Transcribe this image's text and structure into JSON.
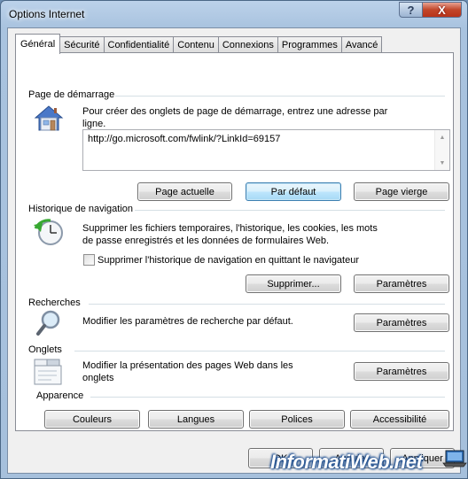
{
  "window": {
    "title": "Options Internet",
    "help_label": "?",
    "close_label": "X"
  },
  "tabs": [
    {
      "label": "Général"
    },
    {
      "label": "Sécurité"
    },
    {
      "label": "Confidentialité"
    },
    {
      "label": "Contenu"
    },
    {
      "label": "Connexions"
    },
    {
      "label": "Programmes"
    },
    {
      "label": "Avancé"
    }
  ],
  "homepage": {
    "title": "Page de démarrage",
    "description": "Pour créer des onglets de page de démarrage, entrez une adresse par ligne.",
    "url_value": "http://go.microsoft.com/fwlink/?LinkId=69157",
    "current_page_label": "Page actuelle",
    "default_label": "Par défaut",
    "blank_label": "Page vierge"
  },
  "history": {
    "title": "Historique de navigation",
    "description": "Supprimer les fichiers temporaires, l'historique, les cookies, les mots de passe enregistrés et les données de formulaires Web.",
    "checkbox_label": "Supprimer l'historique de navigation en quittant le navigateur",
    "checkbox_checked": false,
    "delete_label": "Supprimer...",
    "settings_label": "Paramètres"
  },
  "search": {
    "title": "Recherches",
    "description": "Modifier les paramètres de recherche par défaut.",
    "settings_label": "Paramètres"
  },
  "tabs_section": {
    "title": "Onglets",
    "description": "Modifier la présentation des pages Web dans les onglets",
    "settings_label": "Paramètres"
  },
  "appearance": {
    "title": "Apparence",
    "colors_label": "Couleurs",
    "languages_label": "Langues",
    "fonts_label": "Polices",
    "accessibility_label": "Accessibilité"
  },
  "footer": {
    "ok_label": "OK",
    "cancel_label": "Annuler",
    "apply_label": "Appliquer"
  },
  "watermark": "InformatiWeb.net",
  "colors": {
    "accent": "#3c7fb1",
    "window_frame": "#a9c3df",
    "close_button": "#c2462a"
  }
}
